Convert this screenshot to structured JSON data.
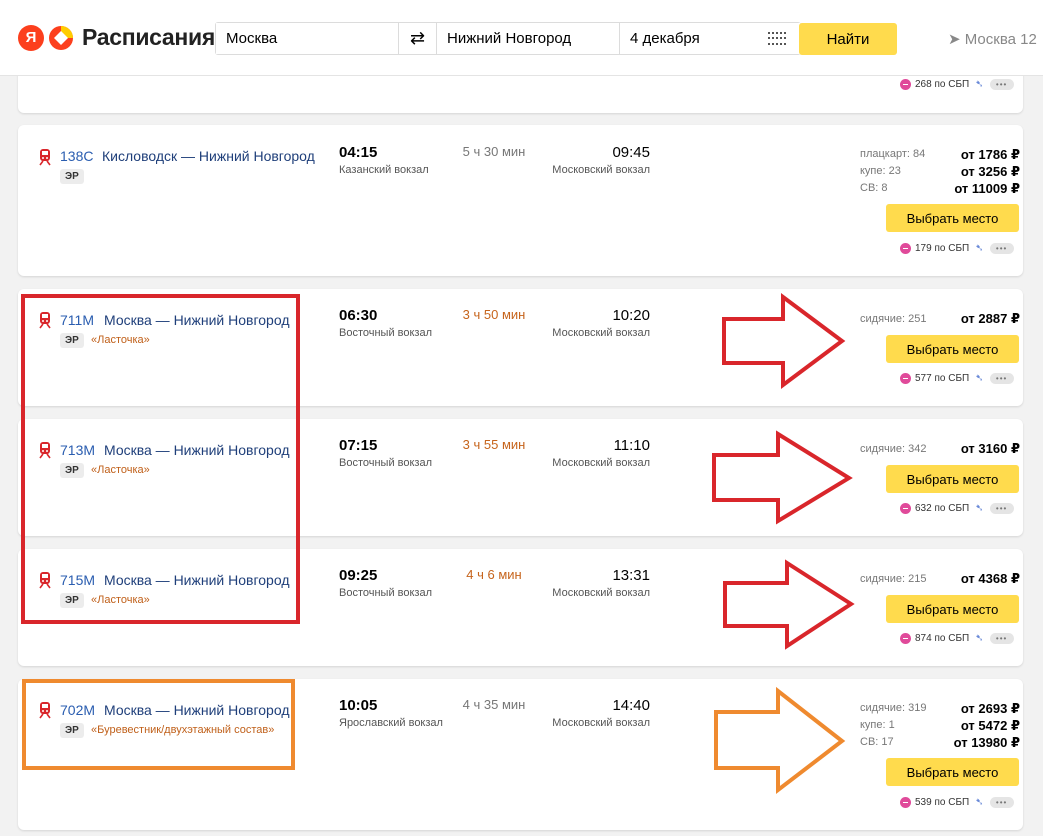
{
  "header": {
    "logo_ya": "Я",
    "logo_text": "Расписания",
    "from": "Москва",
    "to": "Нижний Новгород",
    "date": "4 декабря",
    "find_button": "Найти",
    "geo": "Москва",
    "geo_extra": "12",
    "icons": [
      "swap-icon",
      "calendar-icon",
      "location-arrow-icon"
    ]
  },
  "top_card": {
    "sbp": "268 по СБП"
  },
  "trains": [
    {
      "number": "138С",
      "route": "Кисловодск — Нижний Новгород",
      "type": "ЭР",
      "brand": "",
      "dep_time": "04:15",
      "dep_station": "Казанский вокзал",
      "duration": "5 ч 30 мин",
      "duration_highlight": false,
      "arr_time": "09:45",
      "arr_station": "Московский вокзал",
      "seats": [
        {
          "label": "плацкарт: 84",
          "price": "от 1786 ₽"
        },
        {
          "label": "купе: 23",
          "price": "от 3256 ₽"
        },
        {
          "label": "СВ: 8",
          "price": "от 11009 ₽"
        }
      ],
      "button": "Выбрать место",
      "sbp": "179 по СБП"
    },
    {
      "number": "711М",
      "route": "Москва — Нижний Новгород",
      "type": "ЭР",
      "brand": "«Ласточка»",
      "dep_time": "06:30",
      "dep_station": "Восточный вокзал",
      "duration": "3 ч 50 мин",
      "duration_highlight": true,
      "arr_time": "10:20",
      "arr_station": "Московский вокзал",
      "seats": [
        {
          "label": "сидячие: 251",
          "price": "от 2887 ₽"
        }
      ],
      "button": "Выбрать место",
      "sbp": "577 по СБП"
    },
    {
      "number": "713М",
      "route": "Москва — Нижний Новгород",
      "type": "ЭР",
      "brand": "«Ласточка»",
      "dep_time": "07:15",
      "dep_station": "Восточный вокзал",
      "duration": "3 ч 55 мин",
      "duration_highlight": true,
      "arr_time": "11:10",
      "arr_station": "Московский вокзал",
      "seats": [
        {
          "label": "сидячие: 342",
          "price": "от 3160 ₽"
        }
      ],
      "button": "Выбрать место",
      "sbp": "632 по СБП"
    },
    {
      "number": "715М",
      "route": "Москва — Нижний Новгород",
      "type": "ЭР",
      "brand": "«Ласточка»",
      "dep_time": "09:25",
      "dep_station": "Восточный вокзал",
      "duration": "4 ч 6 мин",
      "duration_highlight": true,
      "arr_time": "13:31",
      "arr_station": "Московский вокзал",
      "seats": [
        {
          "label": "сидячие: 215",
          "price": "от 4368 ₽"
        }
      ],
      "button": "Выбрать место",
      "sbp": "874 по СБП"
    },
    {
      "number": "702М",
      "route": "Москва — Нижний Новгород",
      "type": "ЭР",
      "brand": "«Буревестник/двухэтажный состав»",
      "dep_time": "10:05",
      "dep_station": "Ярославский вокзал",
      "duration": "4 ч 35 мин",
      "duration_highlight": false,
      "arr_time": "14:40",
      "arr_station": "Московский вокзал",
      "seats": [
        {
          "label": "сидячие: 319",
          "price": "от 2693 ₽"
        },
        {
          "label": "купе: 1",
          "price": "от 5472 ₽"
        },
        {
          "label": "СВ: 17",
          "price": "от 13980 ₽"
        }
      ],
      "button": "Выбрать место",
      "sbp": "539 по СБП"
    }
  ],
  "colors": {
    "accent_yellow": "#ffdb4d",
    "link_blue": "#2a5db0",
    "brand_orange": "#c0601a",
    "annotation_red": "#d9262b",
    "annotation_orange": "#ef8a2f",
    "sbp_pink": "#e04a9a"
  }
}
